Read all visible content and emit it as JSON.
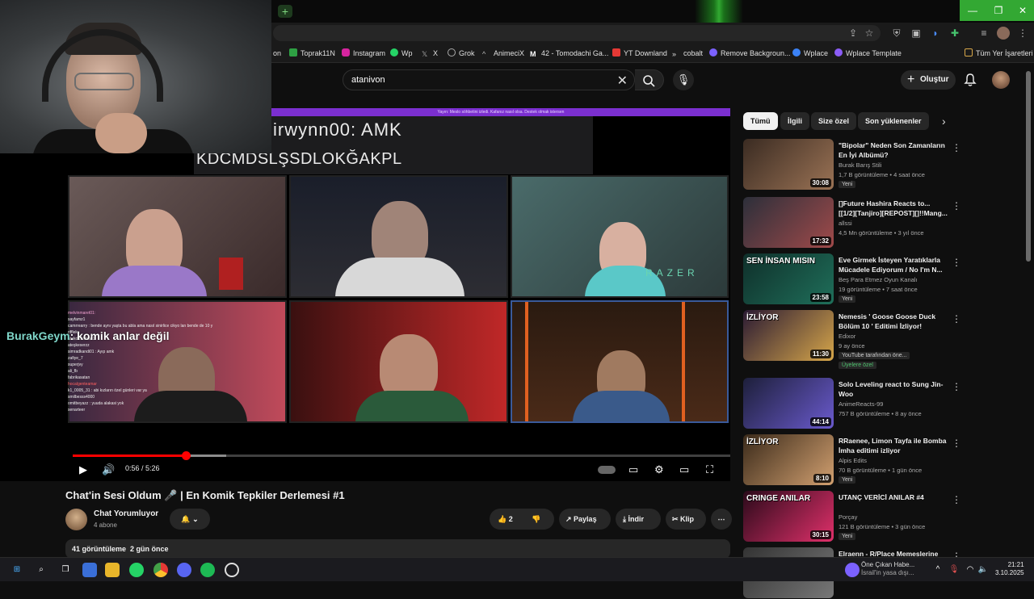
{
  "bookmarks": [
    {
      "label": "on",
      "color": "#888"
    },
    {
      "label": "Toprak11N",
      "color": "#2ea043"
    },
    {
      "label": "Instagram",
      "color": "#d6249f"
    },
    {
      "label": "Wp",
      "color": "#25d366"
    },
    {
      "label": "X",
      "color": "#888"
    },
    {
      "label": "Grok",
      "color": "#aaa"
    },
    {
      "label": "AnimeciX",
      "color": "#bbb"
    },
    {
      "label": "42 - Tomodachi Ga...",
      "color": "#eee"
    },
    {
      "label": "YT Downland",
      "color": "#e53935"
    },
    {
      "label": "cobalt",
      "color": "#ccc"
    },
    {
      "label": "Remove Backgroun...",
      "color": "#7b61ff"
    },
    {
      "label": "Wplace",
      "color": "#3b82f6"
    },
    {
      "label": "Wplace Template",
      "color": "#8b5cf6"
    }
  ],
  "bookmarks_all": "Tüm Yer İşaretleri",
  "search": {
    "value": "atanivon"
  },
  "header": {
    "create_label": "Oluştur"
  },
  "video": {
    "chat_line1": "irwynn00: AMK",
    "chat_line2": "KDCMDSLŞSDLOKĞAKPL",
    "top_banner": "Yayın: Meslo söhbetini izledi. Kafanız nasıl olsa. Destek olmak istersen",
    "overlay_user": "BurakGeym",
    "overlay_text": ": komik anlar değil",
    "chat_lines": [
      "melvinmaret01:",
      "sayfamz1",
      "camrrearry : bende aynı yaşta bu abla ama nasıl sinirlice cikyo lan bende de 10 y",
      "riffleks",
      "atakdizleshan1",
      "",
      "ateşkeserzz",
      "simradkandi01 : Ayıp amk",
      "zafiye_7",
      "superjvy",
      "ali_fb",
      "",
      "fabrikasatan",
      "hocalgenteamar",
      "k1_0005_31 : abi kızların özel günleri var ya",
      "smilbesss4000",
      "omitbeyazz : yuuda alakasi yok",
      "senarteer"
    ],
    "time": "0:56 / 5:26",
    "progress": 0.172
  },
  "below": {
    "title": "Chat'in Sesi Oldum 🎤 | En Komik Tepkiler Derlemesi #1",
    "channel": "Chat Yorumluyor",
    "subs": "4 abone",
    "likes": "2",
    "share": "Paylaş",
    "download": "İndir",
    "clip": "Klip",
    "desc_views": "41 görüntüleme",
    "desc_date": "2 gün önce"
  },
  "chips": [
    {
      "label": "Tümü",
      "active": true
    },
    {
      "label": "İlgili"
    },
    {
      "label": "Size özel"
    },
    {
      "label": "Son yüklenenler"
    }
  ],
  "recs": [
    {
      "title": "\"Bipolar\" Neden Son Zamanların En İyi Albümü?",
      "channel": "Burak Barış Stili",
      "meta": "1,7 B görüntüleme • 4 saat önce",
      "badge": "Yeni",
      "dur": "30:08",
      "c1": "#3a2b22",
      "c2": "#9b7355"
    },
    {
      "title": "[]Future Hashira Reacts to... [[1/2][Tanjiro][REPOST][]!!Mang...",
      "channel": "allssi",
      "meta": "4,5 Mn görüntüleme • 3 yıl önce",
      "badge": "",
      "dur": "17:32",
      "c1": "#2c2f3a",
      "c2": "#a04a4a"
    },
    {
      "title": "Eve Girmek İsteyen Yaratıklarla Mücadele Ediyorum / No I'm N...",
      "channel": "Beş Para Etmez Oyun Kanalı",
      "meta": "19 görüntüleme • 7 saat önce",
      "badge": "Yeni",
      "dur": "23:58",
      "c1": "#0f2f2a",
      "c2": "#1f6f5a",
      "thumbtext": "SEN İNSAN MISIN"
    },
    {
      "title": "Nemesis ' Goose Goose Duck Bölüm 10 ' Editimi İzliyor!",
      "channel": "Edixor",
      "meta": "9 ay önce",
      "badge": "YouTube tarafından öne...",
      "badge2": "Üyelere özel",
      "dur": "11:30",
      "c1": "#2a1a33",
      "c2": "#d6a64a",
      "thumbtext": "İZLİYOR"
    },
    {
      "title": "Solo Leveling react to Sung Jin-Woo",
      "channel": "AnimeReacts-99",
      "meta": "757 B görüntüleme • 8 ay önce",
      "badge": "",
      "dur": "44:14",
      "c1": "#1d1f3a",
      "c2": "#6a5acd"
    },
    {
      "title": "RRaenee, Limon Tayfa ile Bomba İmha editimi izliyor",
      "channel": "Alpis Edits",
      "meta": "70 B görüntüleme • 1 gün önce",
      "badge": "Yeni",
      "dur": "8:10",
      "c1": "#3a2a1a",
      "c2": "#d2a070",
      "thumbtext": "İZLİYOR"
    },
    {
      "title": "UTANÇ VERİCİ ANILAR #4",
      "channel": "Porçay",
      "meta": "121 B görüntüleme • 3 gün önce",
      "badge": "Yeni",
      "dur": "30:15",
      "c1": "#2a0a1a",
      "c2": "#e0306a",
      "thumbtext": "CRINGE ANILAR"
    },
    {
      "title": "Elraenn - R/Place Memeslerine",
      "channel": "",
      "meta": "",
      "badge": "",
      "dur": "",
      "c1": "#333",
      "c2": "#777"
    }
  ],
  "taskbar": {
    "news_title": "Öne Çıkan Habe...",
    "news_sub": "İsrail'in yasa dışı...",
    "time": "21:21",
    "date": "3.10.2025"
  }
}
